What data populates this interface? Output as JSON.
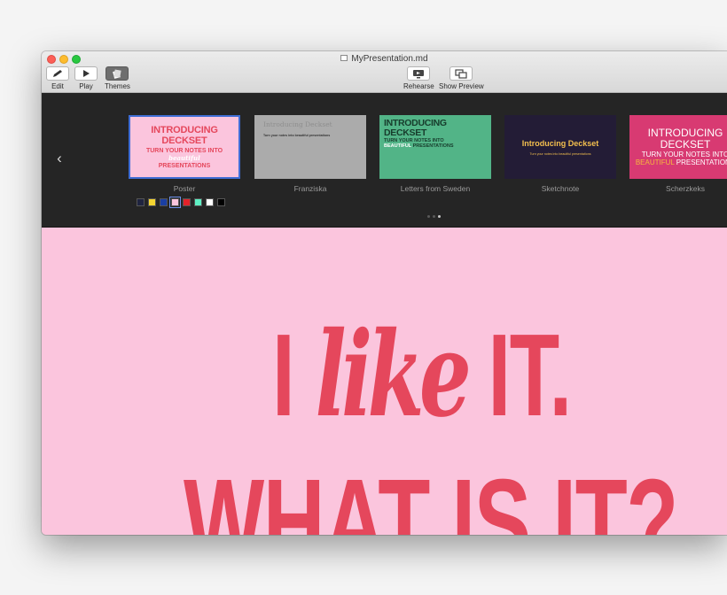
{
  "window": {
    "title": "MyPresentation.md"
  },
  "toolbar": {
    "left": [
      {
        "label": "Edit",
        "icon": "pencil-icon"
      },
      {
        "label": "Play",
        "icon": "play-icon"
      },
      {
        "label": "Themes",
        "icon": "themes-icon"
      }
    ],
    "center": [
      {
        "label": "Rehearse",
        "icon": "rehearse-icon"
      },
      {
        "label": "Show Preview",
        "icon": "preview-icon"
      }
    ]
  },
  "themes": [
    {
      "name": "Poster",
      "selected": true,
      "preview": {
        "line1": "INTRODUCING DECKSET",
        "line2": "TURN YOUR NOTES INTO",
        "accent": "beautiful",
        "line3": "PRESENTATIONS"
      }
    },
    {
      "name": "Franziska",
      "selected": false,
      "preview": {
        "line1": "Introducing Deckset",
        "line2": "Turn your notes into beautiful presentations"
      }
    },
    {
      "name": "Letters from Sweden",
      "selected": false,
      "preview": {
        "line1": "INTRODUCING DECKSET",
        "line2": "TURN YOUR NOTES INTO",
        "accent": "BEAUTIFUL",
        "line3": "PRESENTATIONS"
      }
    },
    {
      "name": "Sketchnote",
      "selected": false,
      "preview": {
        "line1": "Introducing Deckset",
        "line2": "Turn your notes into beautiful presentations"
      }
    },
    {
      "name": "Scherzkeks",
      "selected": false,
      "preview": {
        "line1": "INTRODUCING DECKSET",
        "line2": "TURN YOUR NOTES INTO",
        "accent": "BEAUTIFUL",
        "line3": "PRESENTATIONS"
      }
    }
  ],
  "swatches": [
    "#1f2440",
    "#f5d531",
    "#1a3fa3",
    "#fbc5dd",
    "#e3222a",
    "#5ff0c4",
    "#ffffff",
    "#000000"
  ],
  "selected_swatch_index": 3,
  "pager": {
    "pages": 3,
    "current_index": 2
  },
  "slide": {
    "line1_start": "I ",
    "line1_script": "like",
    "line1_end": " IT.",
    "line2": "WHAT IS IT?",
    "text_color": "#e5475c",
    "background": "#fbc5dd"
  }
}
